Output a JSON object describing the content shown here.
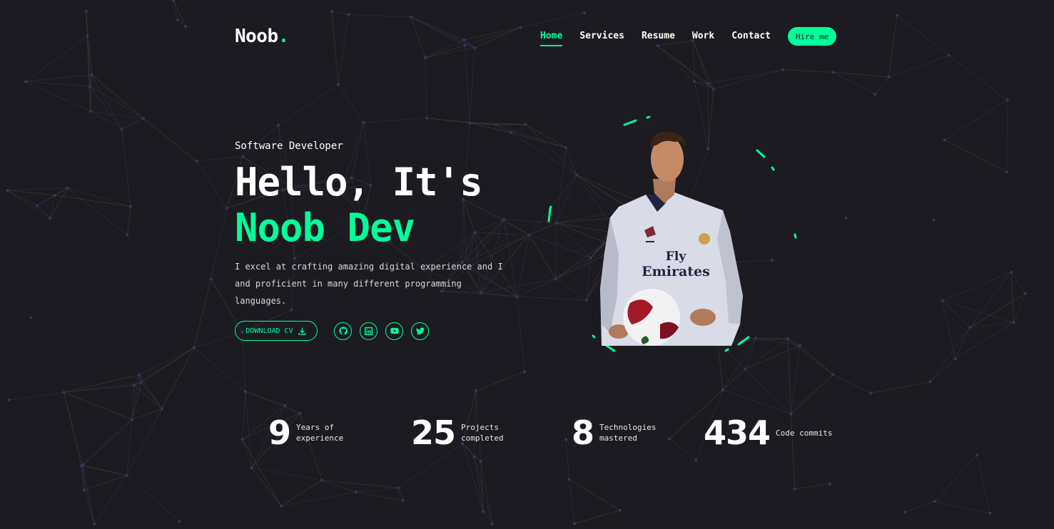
{
  "brand": {
    "name": "Noob",
    "dot": ".",
    "accent_color": "#00ff99"
  },
  "nav": {
    "items": [
      {
        "label": "Home",
        "active": true
      },
      {
        "label": "Services",
        "active": false
      },
      {
        "label": "Resume",
        "active": false
      },
      {
        "label": "Work",
        "active": false
      },
      {
        "label": "Contact",
        "active": false
      }
    ],
    "hire_label": "Hire me"
  },
  "hero": {
    "subtitle": "Software Developer",
    "title_line1": "Hello, It's",
    "title_line2": "Noob Dev",
    "description": "I excel at crafting amazing digital experience and I and proficient in many different programming languages.",
    "cv_label": "DOWNLOAD CV",
    "socials": [
      "github-icon",
      "linkedin-icon",
      "youtube-icon",
      "twitter-icon"
    ]
  },
  "stats": [
    {
      "value": "9",
      "label": "Years of experience"
    },
    {
      "value": "25",
      "label": "Projects completed"
    },
    {
      "value": "8",
      "label": "Technologies mastered"
    },
    {
      "value": "434",
      "label": "Code commits"
    }
  ],
  "photo": {
    "jersey_text_line1": "Fly",
    "jersey_text_line2": "Emirates"
  },
  "colors": {
    "background": "#1c1b22",
    "accent": "#00ff99",
    "text": "#ffffff"
  }
}
